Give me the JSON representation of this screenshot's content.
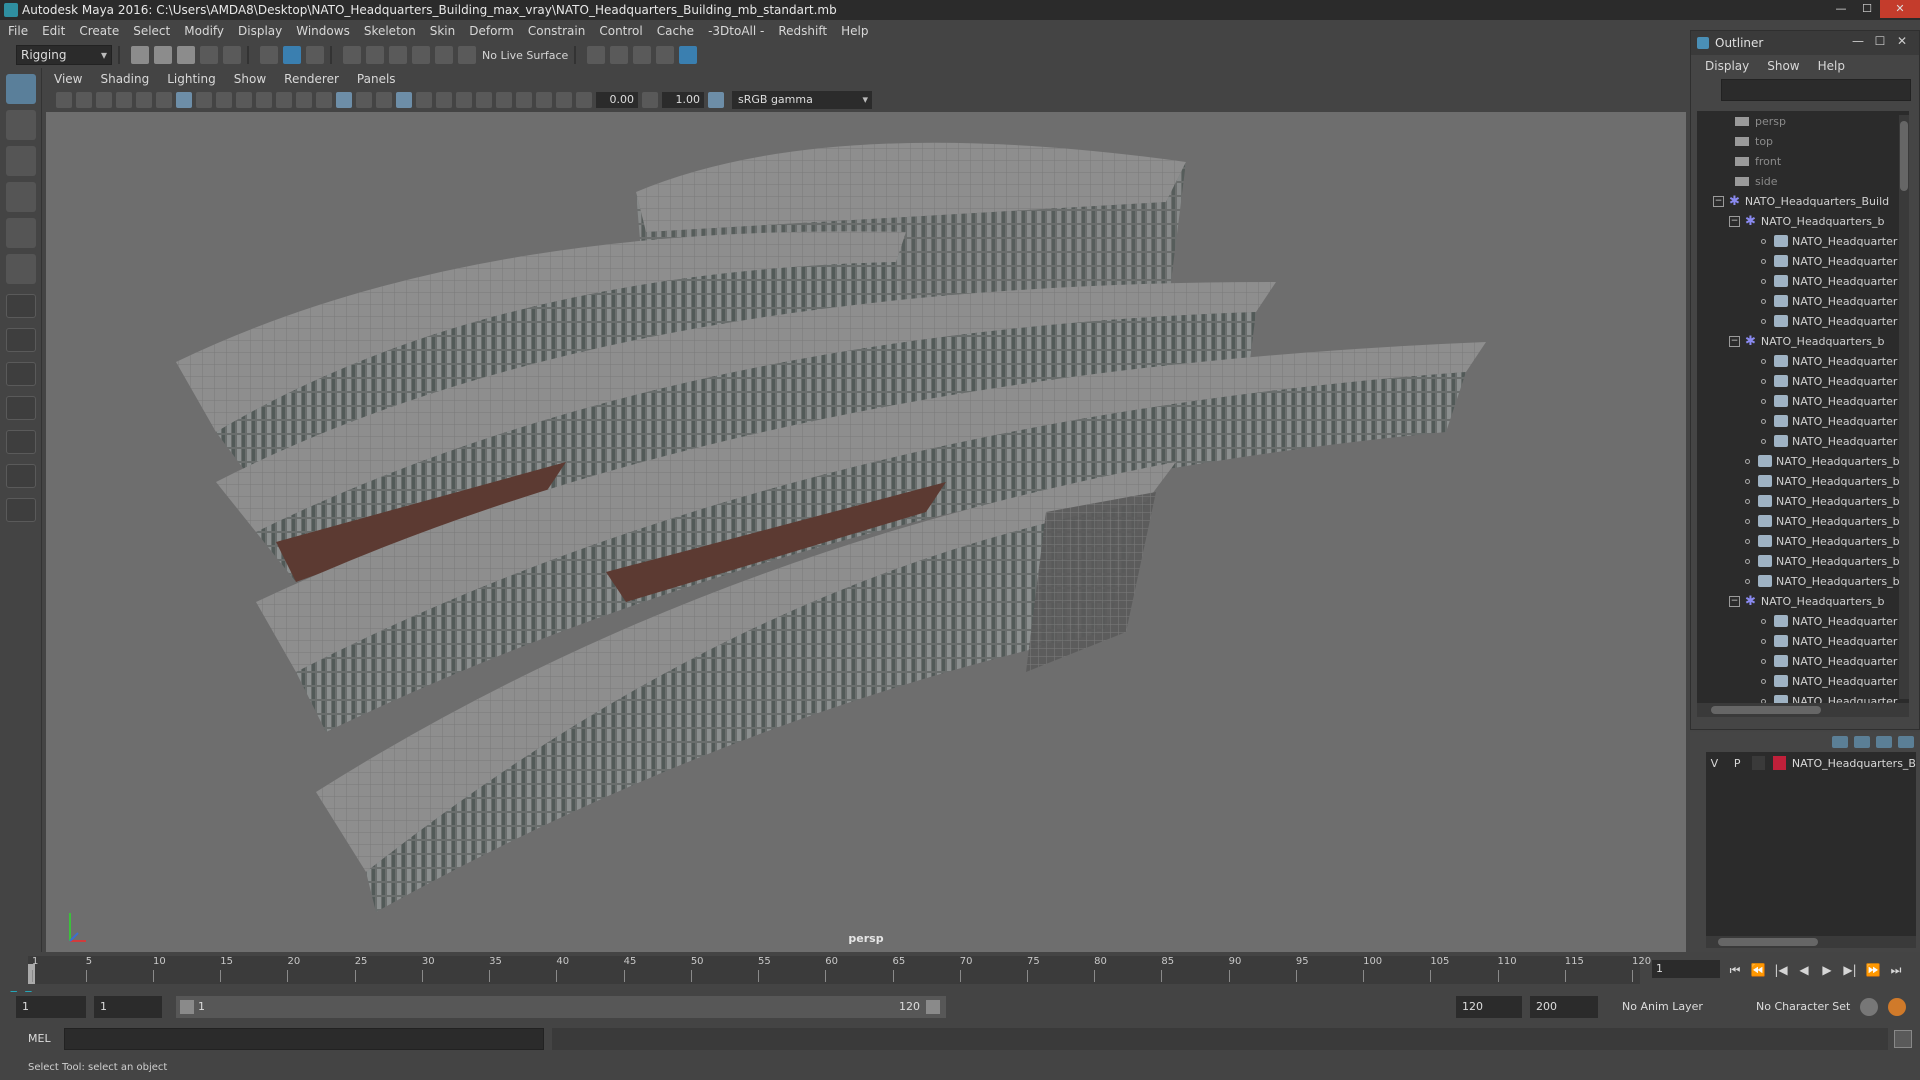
{
  "window": {
    "title": "Autodesk Maya 2016: C:\\Users\\AMDA8\\Desktop\\NATO_Headquarters_Building_max_vray\\NATO_Headquarters_Building_mb_standart.mb"
  },
  "menu": [
    "File",
    "Edit",
    "Create",
    "Select",
    "Modify",
    "Display",
    "Windows",
    "Skeleton",
    "Skin",
    "Deform",
    "Constrain",
    "Control",
    "Cache",
    "-3DtoAll -",
    "Redshift",
    "Help"
  ],
  "statusline": {
    "mode": "Rigging",
    "live_surface": "No Live Surface"
  },
  "panel": {
    "menu": [
      "View",
      "Shading",
      "Lighting",
      "Show",
      "Renderer",
      "Panels"
    ],
    "exposure": "0.00",
    "gamma_value": "1.00",
    "color_space": "sRGB gamma",
    "camera": "persp"
  },
  "outliner": {
    "title": "Outliner",
    "menu": [
      "Display",
      "Show",
      "Help"
    ],
    "items": [
      {
        "label": "persp",
        "kind": "camera",
        "level": 0,
        "dim": true
      },
      {
        "label": "top",
        "kind": "camera",
        "level": 0,
        "dim": true
      },
      {
        "label": "front",
        "kind": "camera",
        "level": 0,
        "dim": true
      },
      {
        "label": "side",
        "kind": "camera",
        "level": 0,
        "dim": true
      },
      {
        "label": "NATO_Headquarters_Build",
        "kind": "group",
        "level": 0,
        "expander": "−"
      },
      {
        "label": "NATO_Headquarters_b",
        "kind": "group",
        "level": 1,
        "expander": "−"
      },
      {
        "label": "NATO_Headquarter",
        "kind": "mesh",
        "level": 2
      },
      {
        "label": "NATO_Headquarter",
        "kind": "mesh",
        "level": 2
      },
      {
        "label": "NATO_Headquarter",
        "kind": "mesh",
        "level": 2
      },
      {
        "label": "NATO_Headquarter",
        "kind": "mesh",
        "level": 2
      },
      {
        "label": "NATO_Headquarter",
        "kind": "mesh",
        "level": 2
      },
      {
        "label": "NATO_Headquarters_b",
        "kind": "group",
        "level": 1,
        "expander": "−"
      },
      {
        "label": "NATO_Headquarter",
        "kind": "mesh",
        "level": 2
      },
      {
        "label": "NATO_Headquarter",
        "kind": "mesh",
        "level": 2
      },
      {
        "label": "NATO_Headquarter",
        "kind": "mesh",
        "level": 2
      },
      {
        "label": "NATO_Headquarter",
        "kind": "mesh",
        "level": 2
      },
      {
        "label": "NATO_Headquarter",
        "kind": "mesh",
        "level": 2
      },
      {
        "label": "NATO_Headquarters_b",
        "kind": "mesh",
        "level": 1
      },
      {
        "label": "NATO_Headquarters_b",
        "kind": "mesh",
        "level": 1
      },
      {
        "label": "NATO_Headquarters_b",
        "kind": "mesh",
        "level": 1
      },
      {
        "label": "NATO_Headquarters_b",
        "kind": "mesh",
        "level": 1
      },
      {
        "label": "NATO_Headquarters_b",
        "kind": "mesh",
        "level": 1
      },
      {
        "label": "NATO_Headquarters_b",
        "kind": "mesh",
        "level": 1
      },
      {
        "label": "NATO_Headquarters_b",
        "kind": "mesh",
        "level": 1
      },
      {
        "label": "NATO_Headquarters_b",
        "kind": "group",
        "level": 1,
        "expander": "−"
      },
      {
        "label": "NATO_Headquarter",
        "kind": "mesh",
        "level": 2
      },
      {
        "label": "NATO_Headquarter",
        "kind": "mesh",
        "level": 2
      },
      {
        "label": "NATO_Headquarter",
        "kind": "mesh",
        "level": 2
      },
      {
        "label": "NATO_Headquarter",
        "kind": "mesh",
        "level": 2
      },
      {
        "label": "NATO_Headquarter",
        "kind": "mesh",
        "level": 2
      }
    ]
  },
  "layers": {
    "visible": "V",
    "playback": "P",
    "name": "NATO_Headquarters_B",
    "color": "#c0203a"
  },
  "timeline": {
    "ticks": [
      "1",
      "5",
      "10",
      "15",
      "20",
      "25",
      "30",
      "35",
      "40",
      "45",
      "50",
      "55",
      "60",
      "65",
      "70",
      "75",
      "80",
      "85",
      "90",
      "95",
      "100",
      "105",
      "110",
      "115",
      "120"
    ],
    "current_frame": "1",
    "playback_icons": [
      "⏮",
      "⏪",
      "|◀",
      "◀",
      "▶",
      "▶|",
      "⏩",
      "⏭"
    ]
  },
  "range": {
    "start": "1",
    "playback_start": "1",
    "slider_start": "1",
    "slider_end": "120",
    "playback_end": "120",
    "end": "200",
    "anim_layer": "No Anim Layer",
    "character_set": "No Character Set"
  },
  "command": {
    "label": "MEL"
  },
  "help": {
    "text": "Select Tool: select an object"
  }
}
